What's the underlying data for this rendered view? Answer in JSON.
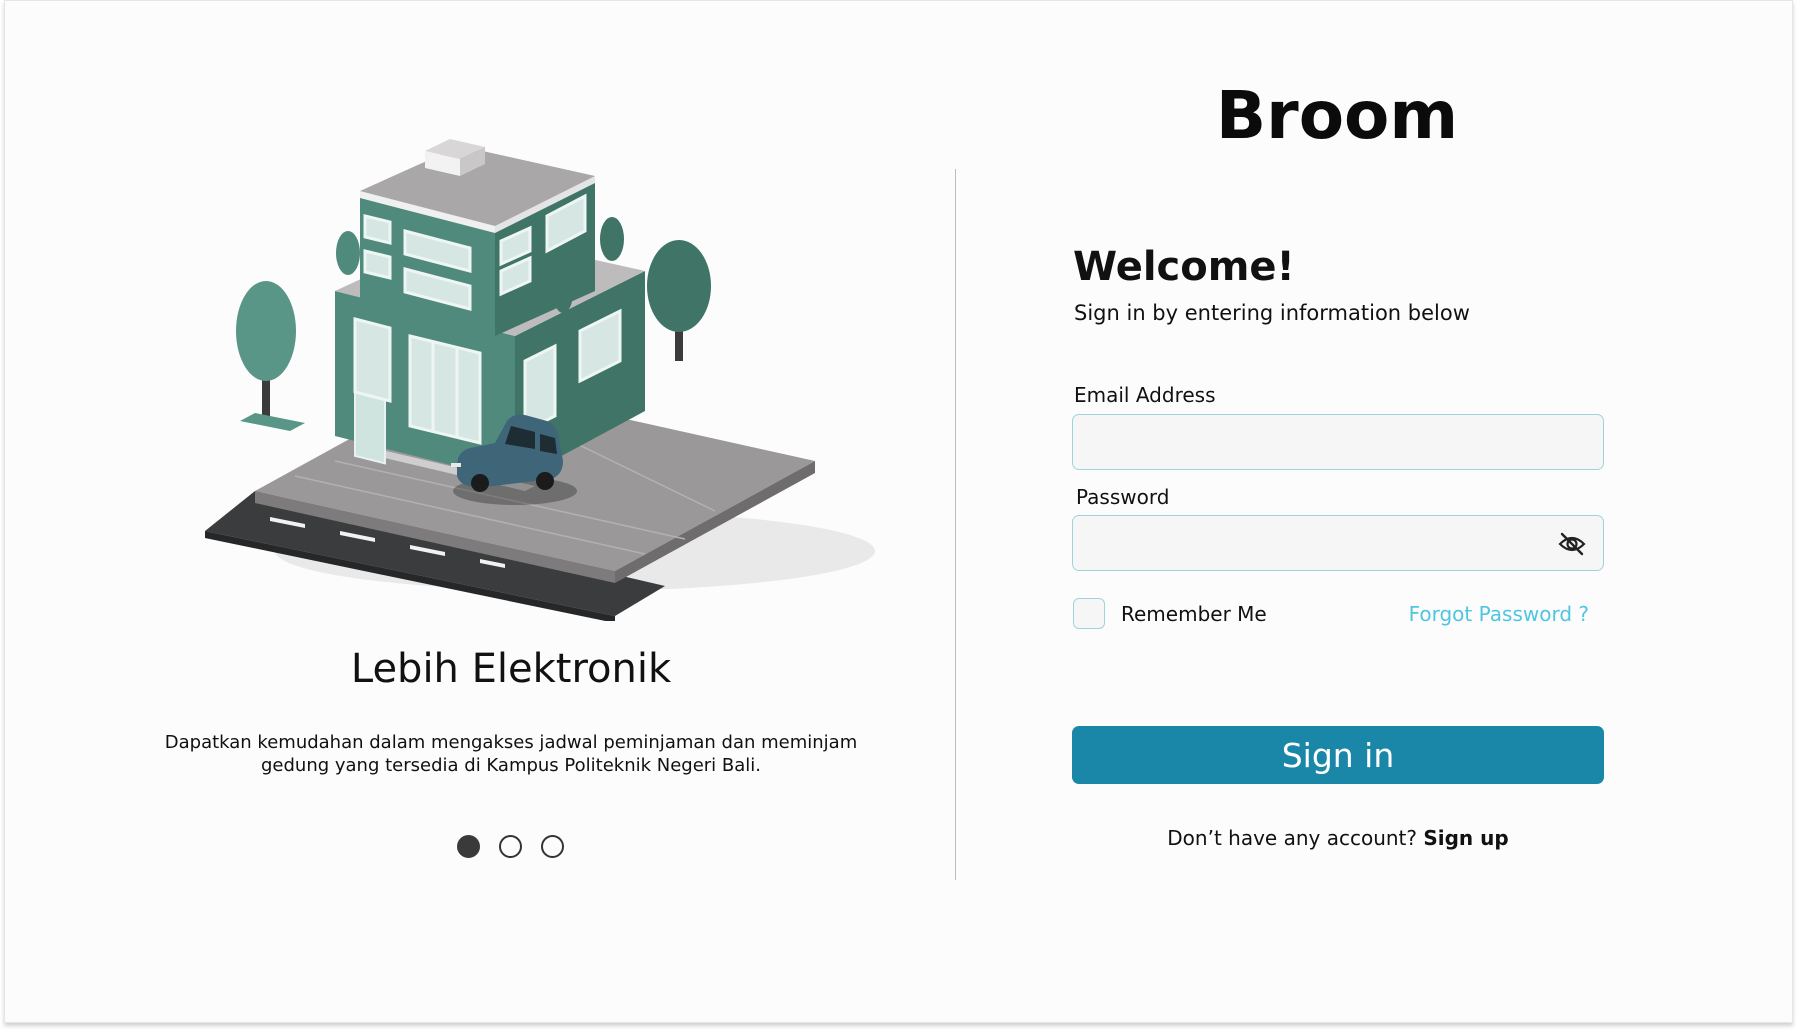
{
  "brand": {
    "name": "Broom"
  },
  "carousel": {
    "title": "Lebih Elektronik",
    "description": "Dapatkan kemudahan dalam mengakses jadwal peminjaman dan meminjam gedung yang tersedia di Kampus Politeknik Negeri Bali.",
    "dots_count": 3,
    "active_index": 0
  },
  "login": {
    "welcome": "Welcome!",
    "subtitle": "Sign in by entering information below",
    "email_label": "Email Address",
    "email_value": "",
    "password_label": "Password",
    "password_value": "",
    "remember_label": "Remember Me",
    "remember_checked": false,
    "forgot_label": "Forgot Password ?",
    "signin_label": "Sign in",
    "signup_prompt": "Don’t have any account?",
    "signup_link": "Sign up"
  },
  "colors": {
    "primary": "#1a87a8",
    "link": "#4fc6e0",
    "field_border": "#9fd3dc",
    "building": "#4f8a7c"
  },
  "icons": {
    "password_toggle": "eye-off-icon"
  }
}
